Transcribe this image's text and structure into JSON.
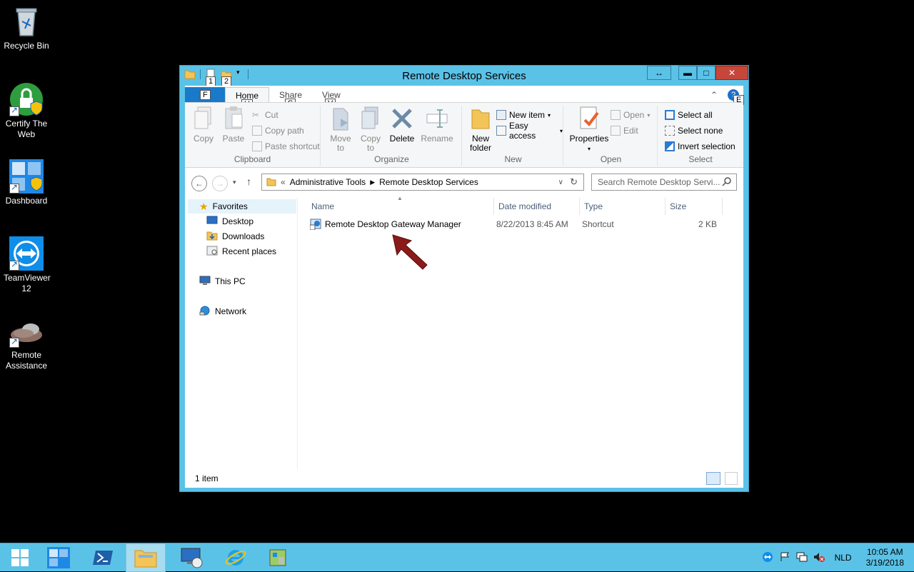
{
  "desktop": {
    "icons": [
      {
        "label": "Recycle Bin"
      },
      {
        "label": "Certify The Web"
      },
      {
        "label": "Dashboard"
      },
      {
        "label": "TeamViewer 12"
      },
      {
        "label": "Remote Assistance"
      }
    ]
  },
  "window": {
    "title": "Remote Desktop Services",
    "quick_access_keytips": [
      "1",
      "2"
    ],
    "ribbon": {
      "file_tab": "F",
      "tabs": [
        {
          "label": "Home",
          "keytip": "H"
        },
        {
          "label": "Share",
          "keytip": "S"
        },
        {
          "label": "View",
          "keytip": "V"
        }
      ],
      "help_keytip": "E",
      "groups": {
        "clipboard": {
          "label": "Clipboard",
          "copy": "Copy",
          "paste": "Paste",
          "cut": "Cut",
          "copy_path": "Copy path",
          "paste_shortcut": "Paste shortcut"
        },
        "organize": {
          "label": "Organize",
          "move_to": "Move to",
          "copy_to": "Copy to",
          "delete": "Delete",
          "rename": "Rename"
        },
        "new": {
          "label": "New",
          "new_folder": "New folder",
          "new_item": "New item",
          "easy_access": "Easy access"
        },
        "open": {
          "label": "Open",
          "properties": "Properties",
          "open": "Open",
          "edit": "Edit"
        },
        "select": {
          "label": "Select",
          "select_all": "Select all",
          "select_none": "Select none",
          "invert_selection": "Invert selection"
        }
      }
    },
    "address": {
      "prefix": "«",
      "segments": [
        "Administrative Tools",
        "Remote Desktop Services"
      ],
      "search_placeholder": "Search Remote Desktop Servi..."
    },
    "navpane": {
      "favorites": "Favorites",
      "desktop": "Desktop",
      "downloads": "Downloads",
      "recent": "Recent places",
      "this_pc": "This PC",
      "network": "Network"
    },
    "columns": [
      "Name",
      "Date modified",
      "Type",
      "Size"
    ],
    "files": [
      {
        "name": "Remote Desktop Gateway Manager",
        "date": "8/22/2013 8:45 AM",
        "type": "Shortcut",
        "size": "2 KB"
      }
    ],
    "status": "1 item"
  },
  "taskbar": {
    "language": "NLD",
    "time": "10:05 AM",
    "date": "3/19/2018"
  },
  "colors": {
    "accent": "#5bc2e7",
    "file_tab": "#1979ca",
    "close": "#c7463a",
    "arrow": "#8b1a1a"
  }
}
